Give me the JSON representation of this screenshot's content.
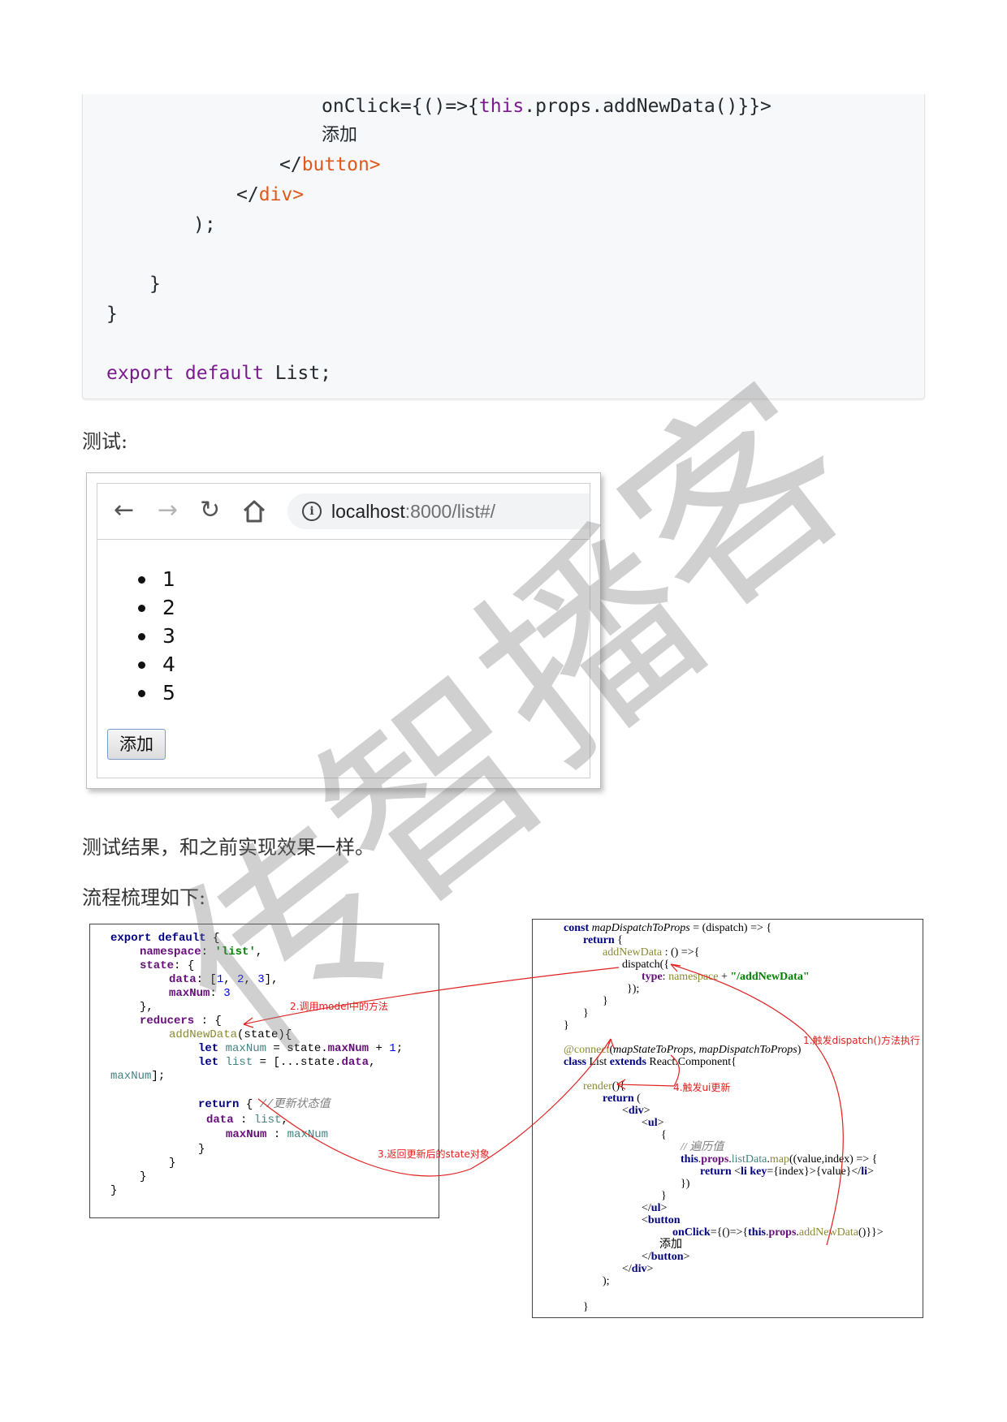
{
  "code_block": {
    "lines": [
      [
        "",
        "onClick={()=>{",
        "this",
        ".props.addNewData()}}>"
      ],
      [
        "",
        "添加",
        "",
        ""
      ],
      [
        "</",
        "button",
        ">",
        ""
      ],
      [
        "</",
        "div",
        ">",
        ""
      ],
      [
        ");",
        "",
        "",
        ""
      ],
      [
        "}",
        "",
        "",
        ""
      ],
      [
        "}",
        "",
        "",
        ""
      ],
      [
        "export default",
        " List;",
        "",
        ""
      ]
    ]
  },
  "text": {
    "test_label": "测试:",
    "result_text": "测试结果，和之前实现效果一样。",
    "flow_label": "流程梳理如下:"
  },
  "browser": {
    "back_icon": "back-arrow-icon",
    "url_host": "localhost",
    "url_rest": ":8000/list#/",
    "list_items": [
      "1",
      "2",
      "3",
      "4",
      "5"
    ],
    "add_button": "添加"
  },
  "flow": {
    "left_code": {
      "l1a": "export default",
      "l1b": " {",
      "l2a": "namespace",
      "l2b": ": ",
      "l2c": "'list'",
      "l2d": ",",
      "l3a": "state",
      "l3b": ": {",
      "l4a": "data",
      "l4b": ": [",
      "l4c": "1",
      "l4d": ", ",
      "l4e": "2",
      "l4f": ", ",
      "l4g": "3",
      "l4h": "],",
      "l5a": "maxNum",
      "l5b": ": ",
      "l5c": "3",
      "l6": "},",
      "l7a": "reducers",
      "l7b": " : {",
      "l8a": "addNewData",
      "l8b": "(state){",
      "l9a": "let",
      "l9b": " maxNum",
      "l9c": " = state.",
      "l9d": "maxNum",
      "l9e": " + ",
      "l9f": "1",
      "l9g": ";",
      "l10a": "let",
      "l10b": " list",
      "l10c": " = [...state.",
      "l10d": "data",
      "l10e": ",",
      "l11a": "maxNum",
      "l11b": "];",
      "l12a": "return",
      "l12b": " { ",
      "l12c": "//更新状态值",
      "l13a": "data",
      "l13b": " : ",
      "l13c": "list",
      "l13d": ",",
      "l14a": "maxNum",
      "l14b": " : ",
      "l14c": "maxNum",
      "l15": "}",
      "l16": "}",
      "l17": "}",
      "l18": "}"
    },
    "right_code": {
      "r1a": "const",
      "r1b": " mapDispatchToProps",
      "r1c": " = (dispatch) => {",
      "r2a": "return",
      "r2b": " {",
      "r3a": "addNewData",
      "r3b": " : () =>{",
      "r4": "dispatch({",
      "r5a": "type",
      "r5b": ": ",
      "r5c": "namespace",
      "r5d": " + ",
      "r5e": "\"/addNewData\"",
      "r6": "});",
      "r7": "}",
      "r8": "}",
      "r9": "}",
      "r10a": "@connect",
      "r10b": "(",
      "r10c": "mapStateToProps",
      "r10d": ", ",
      "r10e": "mapDispatchToProps",
      "r10f": ")",
      "r11a": "class",
      "r11b": " List ",
      "r11c": "extends",
      "r11d": " React.Component{",
      "r12a": "render",
      "r12b": "(){",
      "r13a": "return",
      "r13b": " (",
      "r14a": "<",
      "r14b": "div",
      "r14c": ">",
      "r15a": "<",
      "r15b": "ul",
      "r15c": ">",
      "r16": "{",
      "r17": "// 遍历值",
      "r18a": "this",
      "r18b": ".",
      "r18c": "props",
      "r18d": ".",
      "r18e": "listData",
      "r18f": ".",
      "r18g": "map",
      "r18h": "((value,index) => {",
      "r19a": "return",
      "r19b": " <",
      "r19c": "li",
      "r19d": " ",
      "r19e": "key",
      "r19f": "={index}>{value}</",
      "r19g": "li",
      "r19h": ">",
      "r20": "})",
      "r21": "}",
      "r22a": "</",
      "r22b": "ul",
      "r22c": ">",
      "r23a": "<",
      "r23b": "button",
      "r24a": "onClick",
      "r24b": "={()=>{",
      "r24c": "this",
      "r24d": ".",
      "r24e": "props",
      "r24f": ".",
      "r24g": "addNewData",
      "r24h": "()}}>",
      "r25": "添加",
      "r26a": "</",
      "r26b": "button",
      "r26c": ">",
      "r27a": "</",
      "r27b": "div",
      "r27c": ">",
      "r28": ");",
      "r29": "}"
    },
    "notes": {
      "n1": "1.触发dispatch()方法执行",
      "n2": "2.调用model中的方法",
      "n3": "3.返回更新后的state对象",
      "n4": "4.触发ui更新"
    },
    "arrow_color": "#e02020"
  },
  "watermark": [
    "传",
    "智",
    "播",
    "客"
  ]
}
